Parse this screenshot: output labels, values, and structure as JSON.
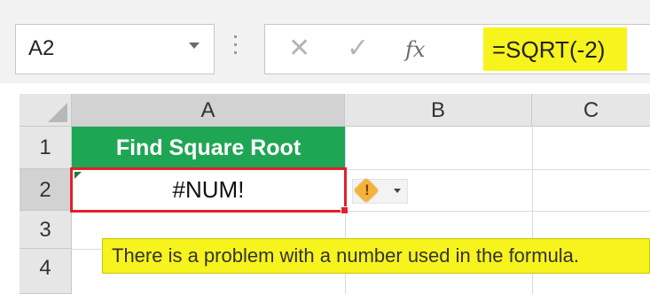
{
  "formula_bar": {
    "name_box": "A2",
    "cancel_glyph": "✕",
    "enter_glyph": "✓",
    "fx_label": "fx",
    "formula": "=SQRT(-2)",
    "highlight_color": "#f7f31d"
  },
  "grid": {
    "columns": [
      "A",
      "B",
      "C"
    ],
    "rows": [
      "1",
      "2",
      "3",
      "4"
    ],
    "cells": {
      "A1": "Find Square Root",
      "A2": "#NUM!"
    },
    "header_fill_color": "#1fa655",
    "selection_border_color": "#e0202a"
  },
  "error_indicator": {
    "icon": "warning-icon",
    "mark": "!",
    "tooltip": "There is a problem with a number used in the formula."
  }
}
